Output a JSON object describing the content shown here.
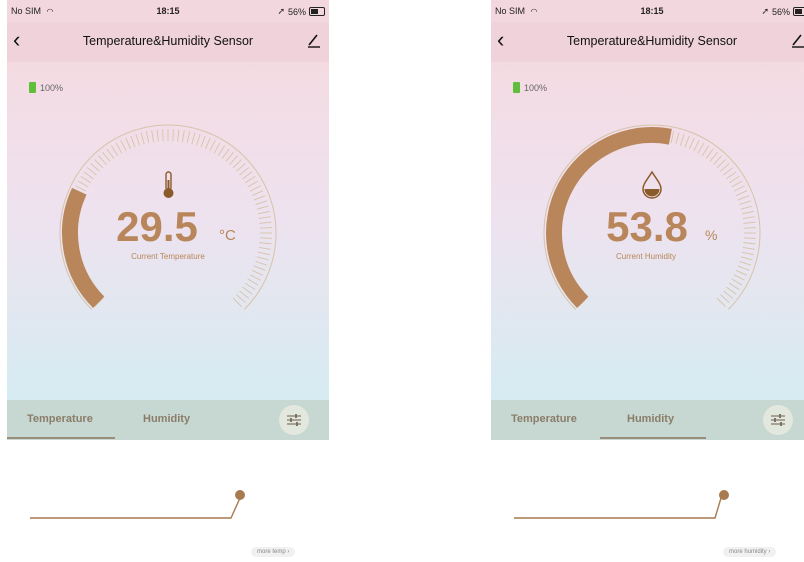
{
  "status": {
    "carrier": "No SIM",
    "time": "18:15",
    "battery": "56%"
  },
  "nav": {
    "title": "Temperature&Humidity Sensor"
  },
  "device_battery": "100%",
  "tabs": [
    "Temperature",
    "Humidity"
  ],
  "temp_screen": {
    "value": "29.5",
    "unit": "°C",
    "caption": "Current Temperature",
    "fill": 0.26,
    "more": "more temp ›",
    "active_tab": 0
  },
  "hum_screen": {
    "value": "53.8",
    "unit": "%",
    "caption": "Current Humidity",
    "fill": 0.54,
    "more": "more humidity ›",
    "active_tab": 1
  },
  "colors": {
    "accent": "#b8865a",
    "accent_dark": "#a26f42",
    "track": "#d7c3a7"
  },
  "icons": [
    "back-arrow-icon",
    "edit-pencil-icon",
    "battery-icon",
    "wifi-icon",
    "location-arrow-icon",
    "thermometer-icon",
    "droplet-icon",
    "adjust-settings-icon"
  ]
}
